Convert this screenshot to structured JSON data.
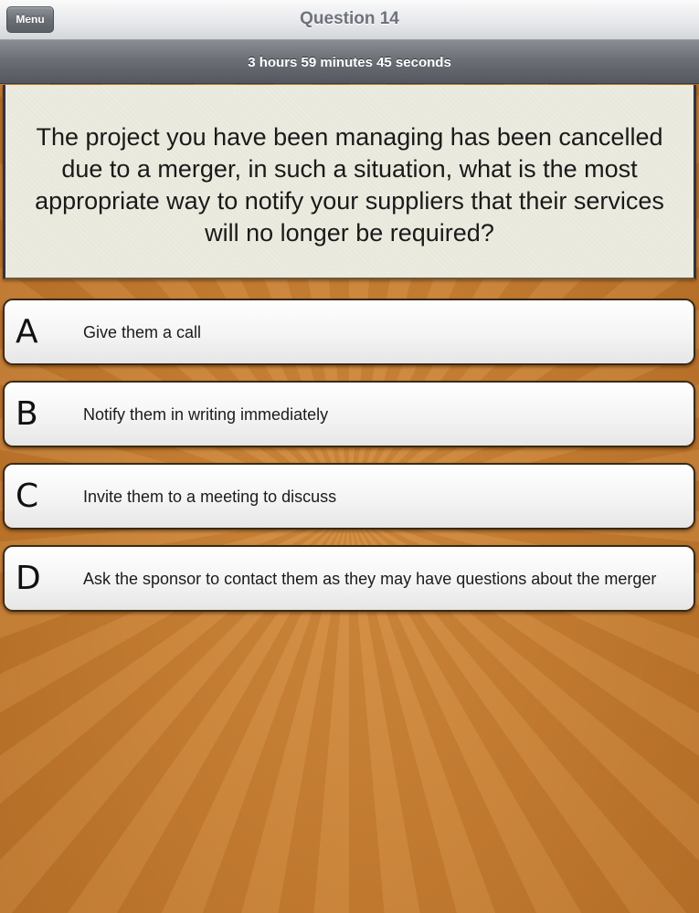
{
  "header": {
    "menu_label": "Menu",
    "title": "Question 14"
  },
  "timer": {
    "text": "3 hours 59 minutes 45 seconds"
  },
  "question": {
    "text": "The project you have been managing has been cancelled due to a merger, in such a situation, what is the most appropriate way to notify your suppliers that their services will no longer be required?"
  },
  "answers": [
    {
      "letter": "A",
      "text": "Give them a call"
    },
    {
      "letter": "B",
      "text": "Notify them in writing immediately"
    },
    {
      "letter": "C",
      "text": "Invite them to a meeting to discuss"
    },
    {
      "letter": "D",
      "text": "Ask the sponsor to contact them as they may have questions about the merger"
    }
  ],
  "colors": {
    "background": "#c27a30",
    "card": "#ecebdf",
    "toolbar": "#e6e7ea",
    "timerbar": "#6c7076"
  }
}
